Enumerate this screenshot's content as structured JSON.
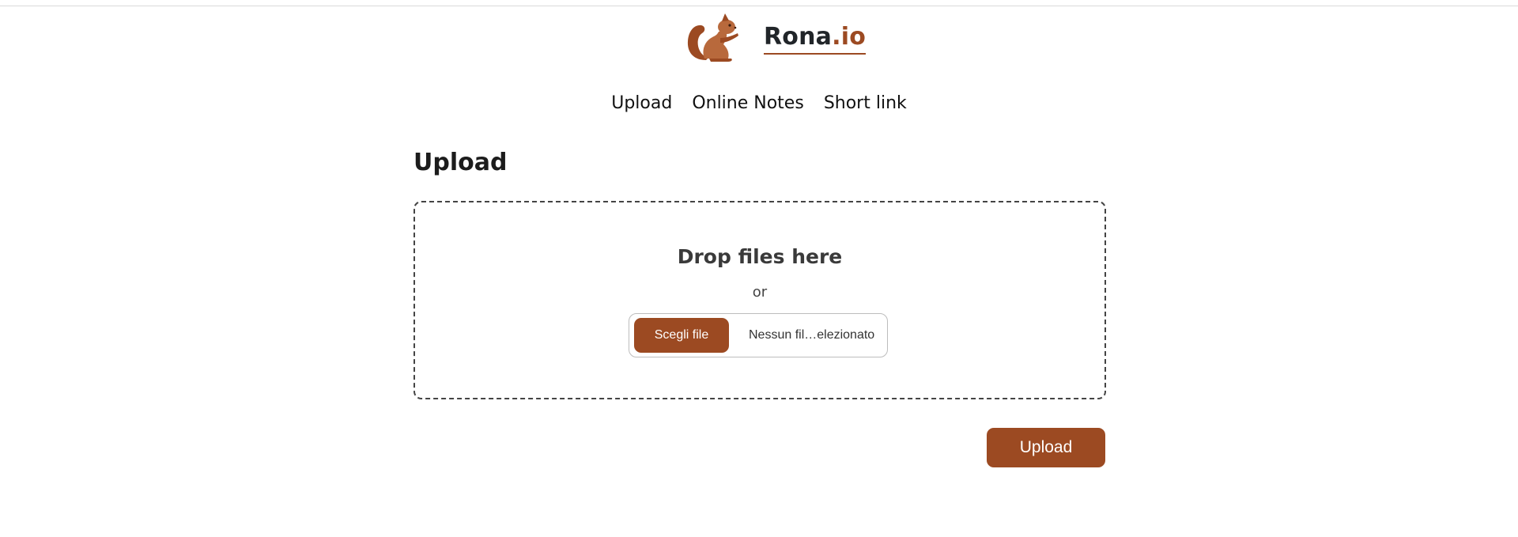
{
  "brand": {
    "name_main": "Rona",
    "name_accent": ".io",
    "logo_icon": "squirrel-icon",
    "accent_color": "#9c4a22"
  },
  "nav": {
    "items": [
      {
        "label": "Upload"
      },
      {
        "label": "Online Notes"
      },
      {
        "label": "Short link"
      }
    ]
  },
  "main": {
    "title": "Upload",
    "dropzone": {
      "title": "Drop files here",
      "or_text": "or",
      "choose_label": "Scegli file",
      "file_status": "Nessun fil…elezionato"
    },
    "upload_label": "Upload"
  }
}
